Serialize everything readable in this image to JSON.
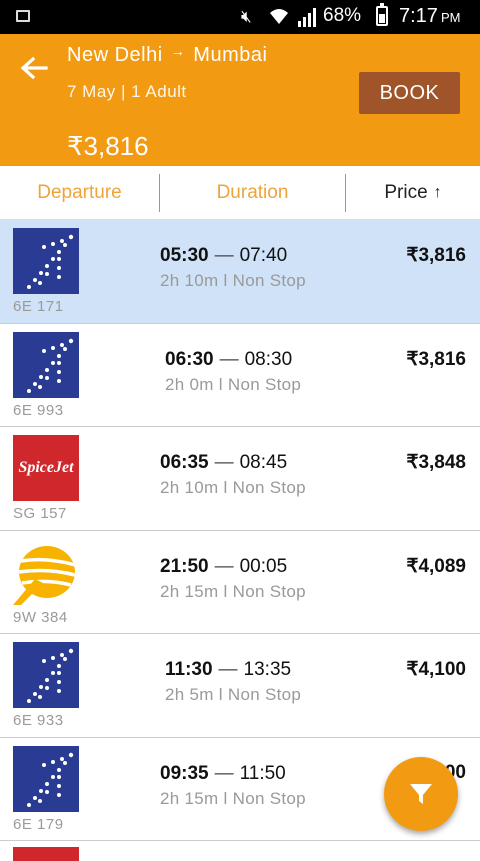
{
  "status": {
    "battery_pct": "68%",
    "time": "7:17",
    "ampm": "PM"
  },
  "header": {
    "from": "New  Delhi",
    "arrow": "→",
    "to": "Mumbai",
    "subinfo": "7  May  |  1  Adult",
    "book_label": "BOOK",
    "price": "₹3,816"
  },
  "sort": {
    "departure": "Departure",
    "duration": "Duration",
    "price": "Price",
    "price_arrow": "↑"
  },
  "flights": [
    {
      "airline": "indigo",
      "number": "6E  171",
      "dep": "05:30",
      "arr": "07:40",
      "meta": "2h  10m  l  Non  Stop",
      "fare": "₹3,816",
      "selected": true
    },
    {
      "airline": "indigo",
      "number": "6E  993",
      "dep": "06:30",
      "arr": "08:30",
      "meta": "2h  0m  l  Non  Stop",
      "fare": "₹3,816"
    },
    {
      "airline": "spicejet",
      "logo_text": "SpiceJet",
      "number": "SG  157",
      "dep": "06:35",
      "arr": "08:45",
      "meta": "2h  10m  l  Non  Stop",
      "fare": "₹3,848"
    },
    {
      "airline": "jet",
      "number": "9W  384",
      "dep": "21:50",
      "arr": "00:05",
      "meta": "2h  15m  l  Non  Stop",
      "fare": "₹4,089"
    },
    {
      "airline": "indigo",
      "number": "6E  933",
      "dep": "11:30",
      "arr": "13:35",
      "meta": "2h  5m  l  Non  Stop",
      "fare": "₹4,100"
    },
    {
      "airline": "indigo",
      "number": "6E  179",
      "dep": "09:35",
      "arr": "11:50",
      "meta": "2h  15m  l  Non  Stop",
      "fare": "00"
    }
  ],
  "colors": {
    "accent": "#f29a11",
    "book": "#a0542a",
    "selected": "#cfe2f7",
    "indigo": "#2a3b94",
    "spicejet": "#d0272d",
    "jet": "#f7b300"
  },
  "icons": {
    "back": "arrow-left-icon",
    "filter": "filter-funnel-icon"
  }
}
